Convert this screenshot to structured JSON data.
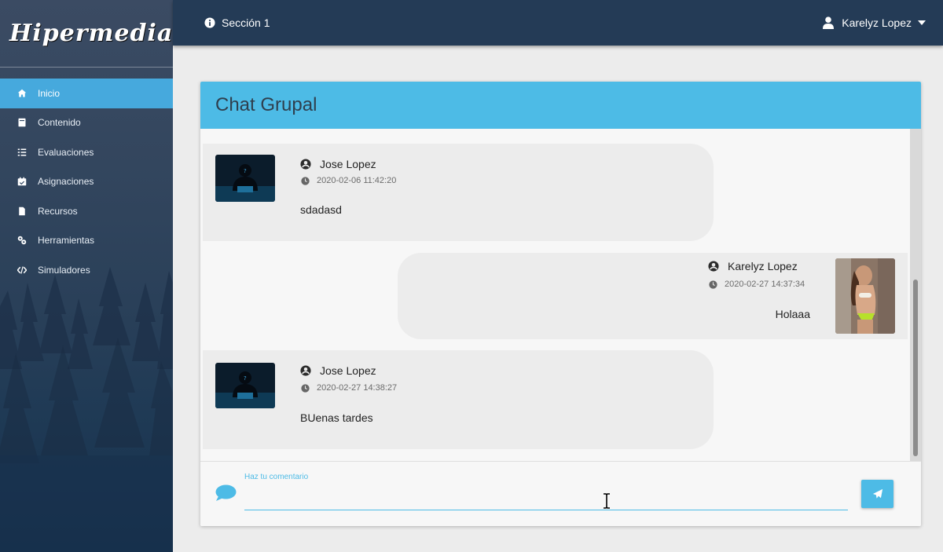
{
  "brand": {
    "logo_text": "Hipermedia"
  },
  "sidebar": {
    "items": [
      {
        "label": "Inicio",
        "icon": "home-icon",
        "active": true
      },
      {
        "label": "Contenido",
        "icon": "book-icon",
        "active": false
      },
      {
        "label": "Evaluaciones",
        "icon": "tasks-icon",
        "active": false
      },
      {
        "label": "Asignaciones",
        "icon": "calendar-check-icon",
        "active": false
      },
      {
        "label": "Recursos",
        "icon": "file-icon",
        "active": false
      },
      {
        "label": "Herramientas",
        "icon": "tools-icon",
        "active": false
      },
      {
        "label": "Simuladores",
        "icon": "code-icon",
        "active": false
      }
    ]
  },
  "topbar": {
    "section_label": "Sección 1",
    "user_name": "Karelyz Lopez"
  },
  "chat": {
    "title": "Chat Grupal",
    "messages": [
      {
        "author": "Jose Lopez",
        "timestamp": "2020-02-06 11:42:20",
        "text": "sdadasd",
        "side": "left"
      },
      {
        "author": "Karelyz Lopez",
        "timestamp": "2020-02-27 14:37:34",
        "text": "Holaaa",
        "side": "right"
      },
      {
        "author": "Jose Lopez",
        "timestamp": "2020-02-27 14:38:27",
        "text": "BUenas tardes",
        "side": "left"
      }
    ],
    "comment_label": "Haz tu comentario",
    "comment_value": ""
  },
  "colors": {
    "accent": "#4dbbe6",
    "topbar": "#243b56",
    "sidebar_active": "#46a9dd"
  }
}
